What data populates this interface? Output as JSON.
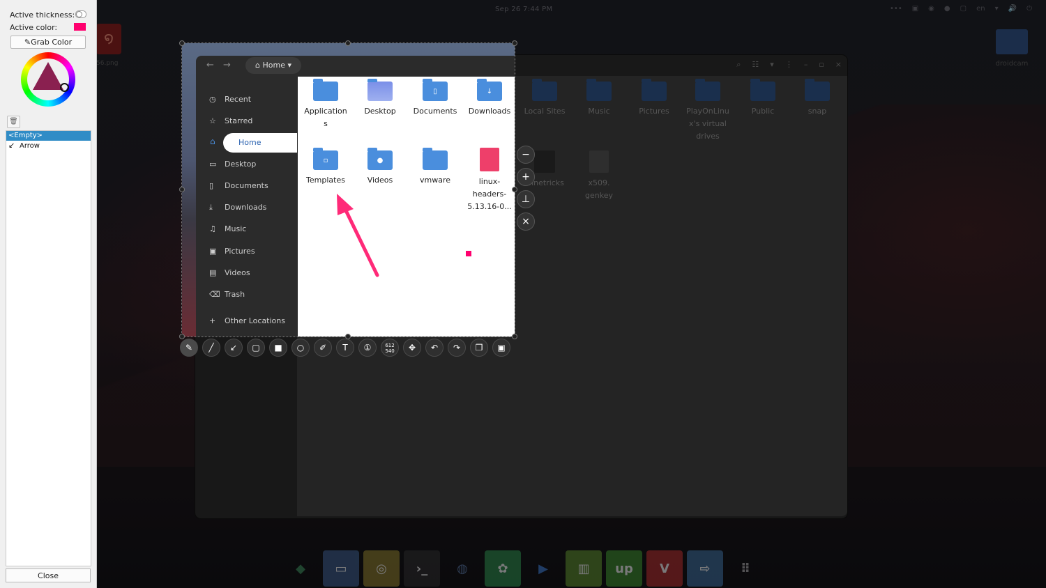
{
  "topbar": {
    "clock": "Sep 26   7:44 PM",
    "tray": [
      "•••",
      "▣",
      "◉",
      "●",
      "▢",
      "en",
      "▾",
      "🔊",
      "⏻"
    ]
  },
  "desktop": {
    "left_icon_label": "56.png",
    "right_icon_label": "droidcam"
  },
  "panel": {
    "thickness_label": "Active thickness:",
    "color_label": "Active color:",
    "active_color": "#ff006e",
    "grab_label": "Grab Color",
    "list_items": [
      "<Empty>",
      "Arrow"
    ],
    "close_label": "Close"
  },
  "files_window": {
    "path_label": "Home",
    "sidebar": [
      {
        "label": "Recent",
        "icon": "clock-icon"
      },
      {
        "label": "Starred",
        "icon": "star-icon"
      },
      {
        "label": "Home",
        "icon": "home-icon",
        "active": true
      },
      {
        "label": "Desktop",
        "icon": "desktop-icon"
      },
      {
        "label": "Documents",
        "icon": "document-icon"
      },
      {
        "label": "Downloads",
        "icon": "download-icon"
      },
      {
        "label": "Music",
        "icon": "music-icon"
      },
      {
        "label": "Pictures",
        "icon": "picture-icon"
      },
      {
        "label": "Videos",
        "icon": "video-icon"
      },
      {
        "label": "Trash",
        "icon": "trash-icon"
      },
      {
        "label": "Other Locations",
        "icon": "plus-icon"
      }
    ],
    "files": [
      {
        "label": "Application\ns"
      },
      {
        "label": "Desktop"
      },
      {
        "label": "Documents"
      },
      {
        "label": "Downloads"
      },
      {
        "label": "Local Sites"
      },
      {
        "label": "Music"
      },
      {
        "label": "Pictures"
      },
      {
        "label": "PlayOnLinu\nx's virtual\ndrives"
      },
      {
        "label": "Public"
      },
      {
        "label": "snap"
      },
      {
        "label": "Templates"
      },
      {
        "label": "Videos"
      },
      {
        "label": "vmware"
      },
      {
        "label": "linux-\nheaders-\n5.13.16-0..."
      },
      {
        "label": "winetricks"
      },
      {
        "label": "x509.\ngenkey"
      }
    ]
  },
  "capture": {
    "selection_size": [
      "612",
      "540"
    ],
    "arrow_color": "#ff2a78"
  }
}
